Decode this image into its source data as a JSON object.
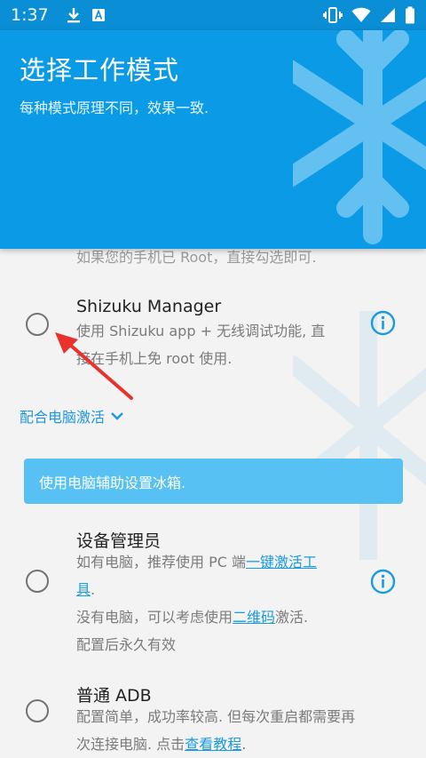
{
  "status_bar": {
    "time": "1:37",
    "icons_left": [
      "download-icon",
      "a-badge-icon"
    ],
    "icons_right": [
      "vibrate-icon",
      "wifi-icon",
      "signal-icon",
      "battery-icon"
    ]
  },
  "header": {
    "title": "选择工作模式",
    "subtitle": "每种模式原理不同，效果一致."
  },
  "content": {
    "partial_text": "如果您的手机已 Root，直接勾选即可.",
    "shizuku": {
      "title": "Shizuku Manager",
      "desc_line1": "使用 Shizuku app + 无线调试功能, 直",
      "desc_line2": "接在手机上免 root 使用."
    },
    "expand_label": "配合电脑激活",
    "banner_text": "使用电脑辅助设置冰箱.",
    "device_admin": {
      "title": "设备管理员",
      "line1_prefix": "如有电脑，推荐使用 PC 端",
      "line1_link": "一键激活工",
      "line2_link": "具",
      "line2_suffix": ".",
      "line3_prefix": "没有电脑，可以考虑使用",
      "line3_link": "二维码",
      "line3_suffix": "激活.",
      "line4": "配置后永久有效"
    },
    "adb": {
      "title": "普通 ADB",
      "line1": "配置简单，成功率较高. 但每次重启都需要再",
      "line2_prefix": "次连接电脑. 点击",
      "line2_link": "查看教程",
      "line2_suffix": "."
    }
  },
  "colors": {
    "header_bg": "#0b9be6",
    "accent": "#1a9ae0",
    "banner_bg": "#58c1f4",
    "arrow": "#e8322b"
  }
}
